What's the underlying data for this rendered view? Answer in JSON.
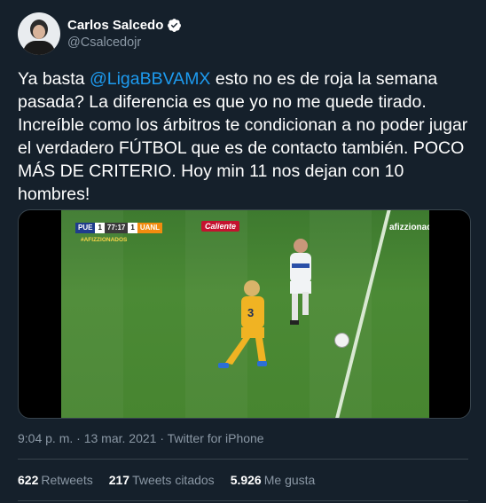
{
  "author": {
    "display_name": "Carlos Salcedo",
    "handle": "@Csalcedojr",
    "verified_icon": "verified-badge-icon"
  },
  "tweet": {
    "text_before_mention": "Ya basta ",
    "mention": "@LigaBBVAMX",
    "text_after_mention": " esto no es de roja la semana pasada? La diferencia es que yo no me quede tirado. Increíble como los árbitros te condicionan a no poder jugar el verdadero FÚTBOL que es de contacto también. POCO MÁS DE CRITERIO. Hoy min 11 nos dejan con 10 hombres!"
  },
  "media": {
    "score_home_team": "PUE",
    "score_home": "1",
    "clock": "77:17",
    "score_away": "1",
    "score_away_team": "UANL",
    "hashtag": "#AFIZZIONADOS",
    "sponsor": "Caliente",
    "broadcaster": "afizzionados",
    "player_number": "3"
  },
  "meta": {
    "time": "9:04 p. m.",
    "separator": " · ",
    "date": "13 mar. 2021",
    "source": "Twitter for iPhone"
  },
  "stats": {
    "retweets_count": "622",
    "retweets_label": "Retweets",
    "quotes_count": "217",
    "quotes_label": "Tweets citados",
    "likes_count": "5.926",
    "likes_label": "Me gusta"
  },
  "colors": {
    "background": "#15202b",
    "accent": "#1d9bf0",
    "muted": "#8b98a5",
    "border": "#38444d"
  }
}
